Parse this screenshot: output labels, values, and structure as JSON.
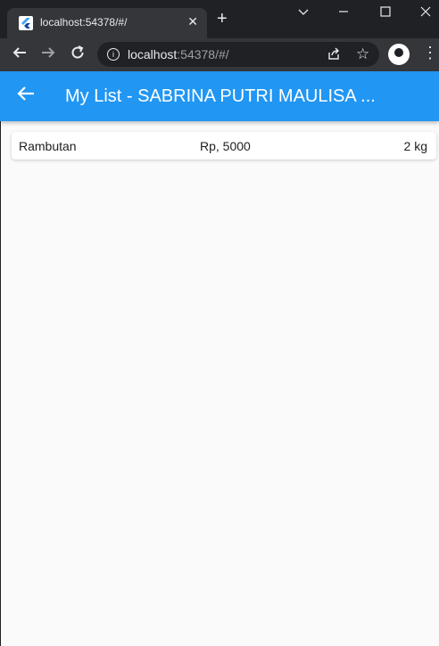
{
  "browser": {
    "tab_title": "localhost:54378/#/",
    "url_host": "localhost",
    "url_path": ":54378/#/",
    "icons": {
      "close": "close-icon",
      "new_tab": "plus-icon",
      "minimize": "minimize-icon",
      "maximize": "maximize-icon",
      "window_close": "close-icon",
      "chevron": "chevron-down-icon",
      "back": "arrow-left-icon",
      "forward": "arrow-right-icon",
      "reload": "reload-icon",
      "info": "info-icon",
      "share": "share-icon",
      "star": "star-icon",
      "profile": "profile-icon",
      "menu": "more-vert-icon"
    }
  },
  "app": {
    "title": "My List - SABRINA PUTRI MAULISA ...",
    "accent_color": "#2196f3",
    "items": [
      {
        "name": "Rambutan",
        "price": "Rp, 5000",
        "weight": "2 kg"
      }
    ]
  }
}
